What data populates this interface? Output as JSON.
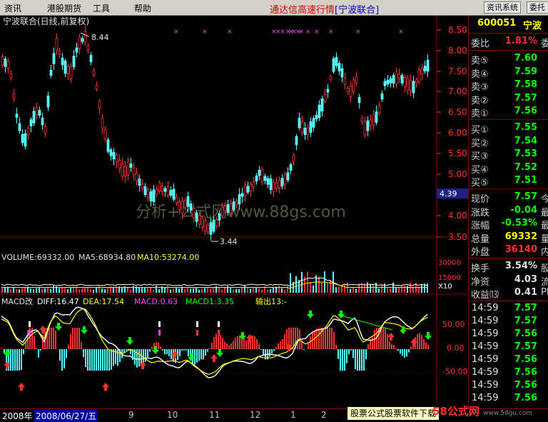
{
  "menu": {
    "items": [
      "资讯",
      "港股期货",
      "工具",
      "帮助"
    ],
    "title": "通达信高速行情",
    "title_tag": "[宁波联合]",
    "btn1": "资讯系统",
    "btn2": "委托"
  },
  "chart": {
    "title": "宁波联合(日线,前复权)",
    "high_label": "8.44",
    "low_label": "3.44",
    "price_marker": "4.39",
    "watermark": "分析+公式网www.88gs.com",
    "y_ticks": [
      "8.50",
      "8.00",
      "7.50",
      "7.00",
      "6.50",
      "6.00",
      "5.50",
      "5.00",
      "4.50",
      "4.00",
      "3.50"
    ]
  },
  "volume": {
    "label": "VOLUME:69332.00",
    "ma5": "MA5:68934.80",
    "ma10": "MA10:53274.00",
    "ticks": [
      "30000",
      "15000"
    ],
    "unit": "X10"
  },
  "macd": {
    "name": "MACD改",
    "diff": "DIFF:16.47",
    "dea": "DEA:17.54",
    "macd": "MACD:0.63",
    "macd1": "MACD1:3.35",
    "out": "输出13:-",
    "ticks": [
      "50.00",
      "0.00",
      "-50.00"
    ]
  },
  "colors": {
    "up": "#ff3232",
    "down": "#54ffff",
    "diff": "#ffffff",
    "dea": "#ffff00",
    "grid": "#800000"
  },
  "panel": {
    "code": "600051",
    "name": "宁波",
    "weibi_label": "委比",
    "weibi": "1.81%",
    "weibi_extra": "委",
    "asks": [
      {
        "label": "卖⑤",
        "price": "7.60"
      },
      {
        "label": "卖④",
        "price": "7.59"
      },
      {
        "label": "卖③",
        "price": "7.58"
      },
      {
        "label": "卖②",
        "price": "7.57"
      },
      {
        "label": "卖①",
        "price": "7.56"
      }
    ],
    "bids": [
      {
        "label": "买①",
        "price": "7.55"
      },
      {
        "label": "买②",
        "price": "7.54"
      },
      {
        "label": "买③",
        "price": "7.53"
      },
      {
        "label": "买④",
        "price": "7.52"
      },
      {
        "label": "买⑤",
        "price": "7.51"
      }
    ],
    "quote": [
      {
        "label": "现价",
        "value": "7.57",
        "extra": "今",
        "color": "#00ff00"
      },
      {
        "label": "涨跌",
        "value": "-0.04",
        "extra": "最",
        "color": "#00ff00"
      },
      {
        "label": "涨幅",
        "value": "-0.53%",
        "extra": "最",
        "color": "#00ff00"
      },
      {
        "label": "总量",
        "value": "69332",
        "extra": "量",
        "color": "#ffff00"
      },
      {
        "label": "外盘",
        "value": "36140",
        "extra": "内",
        "color": "#ff3030"
      }
    ],
    "fin": [
      {
        "label": "换手",
        "value": "3.54%",
        "extra": "股"
      },
      {
        "label": "净资",
        "value": "4.03",
        "extra": "流"
      },
      {
        "label": "收益⒀",
        "value": "0.41",
        "extra": "PE"
      }
    ],
    "ticks": [
      {
        "time": "14:59",
        "price": "7.57"
      },
      {
        "time": "14:59",
        "price": "7.57"
      },
      {
        "time": "14:59",
        "price": "7.56"
      },
      {
        "time": "14:59",
        "price": "7.57"
      },
      {
        "time": "14:59",
        "price": "7.56"
      },
      {
        "time": "14:59",
        "price": "7.56"
      },
      {
        "time": "14:59",
        "price": "7.56"
      },
      {
        "time": "14:59",
        "price": "7.56"
      }
    ]
  },
  "bottom": {
    "year": "2008年",
    "date": "2008/06/27/五",
    "months": [
      "9",
      "10",
      "11",
      "12",
      "1",
      "2"
    ],
    "ad": "股票公式股票软件下载",
    "logo": "58公式网",
    "logo_url": "www.58gu.com"
  }
}
